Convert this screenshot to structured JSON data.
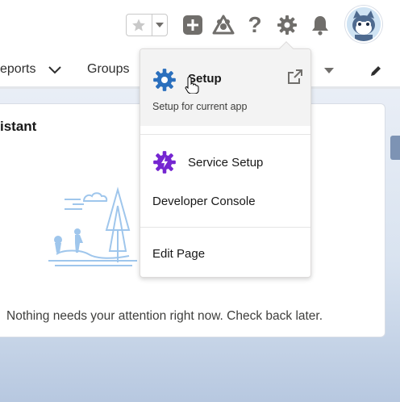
{
  "header": {
    "icons": [
      "star-icon",
      "chevron-down-icon",
      "plus-icon",
      "trailhead-icon",
      "help-icon",
      "gear-icon",
      "bell-icon",
      "avatar"
    ],
    "help_glyph": "?"
  },
  "nav": {
    "items": [
      {
        "label": "eports"
      },
      {
        "label": "Groups"
      }
    ]
  },
  "card": {
    "title": "istant",
    "message": "Nothing needs your attention right now. Check back later."
  },
  "setup_menu": {
    "setup_label": "Setup",
    "setup_subtitle": "Setup for current app",
    "service_setup_label": "Service Setup",
    "developer_console_label": "Developer Console",
    "edit_page_label": "Edit Page"
  },
  "colors": {
    "setup_gear": "#2a6fbd",
    "service_gear": "#7526d1",
    "header_icon": "#706e6b",
    "card_illustration": "#9fc6ec"
  }
}
